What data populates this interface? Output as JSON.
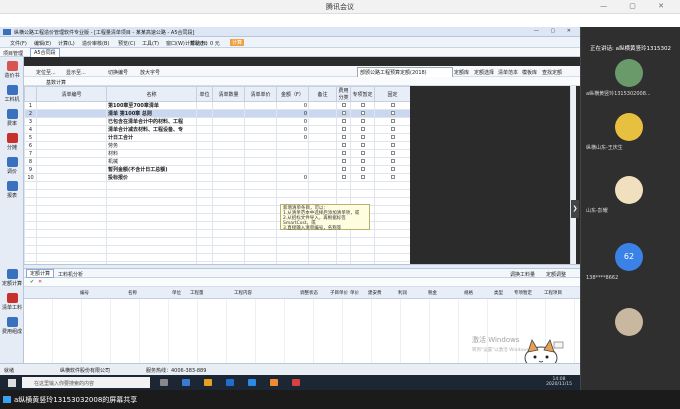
{
  "meeting": {
    "title": "腾讯会议"
  },
  "app": {
    "title": "纵横公路工程造价管理软件专业版 - [工程量清单项目 - 某某高速公路 - A5合同段]",
    "window_controls": "— ▢ ✕",
    "menus": [
      "文件(F)",
      "编辑(E)",
      "计算(L)",
      "造价审核(B)",
      "预览(C)",
      "工具(T)",
      "窗口(W)",
      "帮助(H)"
    ],
    "calc_status": "计算状态：0 元",
    "calc_label": "计算",
    "top_tabs": [
      "项目管理",
      "A5合同段"
    ],
    "sidebar": [
      {
        "label": "造价书",
        "color": "#d9534f"
      },
      {
        "label": "工料机",
        "color": "#3a70c0"
      },
      {
        "label": "费率",
        "color": "#3a70c0"
      },
      {
        "label": "分摊",
        "color": "#c9302c"
      },
      {
        "label": "调价",
        "color": "#3a70c0"
      },
      {
        "label": "报表",
        "color": "#3a70c0"
      },
      {
        "label": "定额计算",
        "color": "#3a70c0"
      },
      {
        "label": "清单工料",
        "color": "#c9302c"
      },
      {
        "label": "费用组成",
        "color": "#3a70c0"
      }
    ],
    "toolbar": [
      "定位至...",
      "显示至...",
      "切换编号",
      "放大字号"
    ],
    "standard_select": "部颁公路工程预算定额(2018)",
    "toolbar_right": [
      "定额库",
      "定额选择",
      "清单范本",
      "模板库",
      "查找定额"
    ],
    "sub_toolbar": [
      "基数计算"
    ],
    "grid": {
      "headers": [
        "",
        "清单编号",
        "名称",
        "单位",
        "清单数量",
        "清单单价",
        "金额（F）",
        "备注",
        "费用分类",
        "专项暂定",
        "固定"
      ],
      "rows": [
        {
          "no": "1",
          "code": "",
          "name": "第100章至700章清单",
          "amount": "0",
          "sel": false
        },
        {
          "no": "2",
          "code": "",
          "name": "清单 第100章 总则",
          "amount": "0",
          "sel": true
        },
        {
          "no": "3",
          "code": "",
          "name": "已包含在清单合计中的材料、工程",
          "amount": "0",
          "sel": false
        },
        {
          "no": "4",
          "code": "",
          "name": "清单合计减去材料、工程设备、专",
          "amount": "0",
          "sel": false
        },
        {
          "no": "5",
          "code": "",
          "name": "计日工合计",
          "amount": "0",
          "sel": false
        },
        {
          "no": "6",
          "code": "",
          "name": "劳务",
          "amount": "",
          "sel": false
        },
        {
          "no": "7",
          "code": "",
          "name": "材料",
          "amount": "",
          "sel": false
        },
        {
          "no": "8",
          "code": "",
          "name": "机械",
          "amount": "",
          "sel": false
        },
        {
          "no": "9",
          "code": "",
          "name": "暂列金额(不含计日工总额)",
          "amount": "",
          "sel": false
        },
        {
          "no": "10",
          "code": "",
          "name": "投标报价",
          "amount": "0",
          "sel": false
        }
      ]
    },
    "tooltip": "新增清单条目，可以：\n1.从清单范本中选择后添加清单项，或\n2.从招标文件导入，再根据标签SmartCost，或\n3.直接输入清单编号，名称等",
    "bottom_tabs": [
      "定额计算",
      "工料机分析"
    ],
    "bottom_right": [
      "调换工料量",
      "定额调整"
    ],
    "bottom_headers": [
      "编号",
      "名称",
      "单位",
      "工程量",
      "工程内容",
      "调整状态",
      "子目单价",
      "单价",
      "建安费",
      "利润",
      "税金",
      "规格",
      "类型",
      "专项暂定",
      "工程项目"
    ],
    "status": {
      "left": "就绪",
      "company": "纵横软件股份有限公司",
      "service": "服务热线：4006-383-889"
    }
  },
  "taskbar": {
    "search_placeholder": "在这里输入你要搜索的内容",
    "time": "14:08",
    "date": "2020/11/15"
  },
  "watermark": {
    "line1": "激活 Windows",
    "line2": "转到\"设置\"以激活 Windows。"
  },
  "meeting_panel": {
    "header": "正在讲话: a纵横黄竖玲1315302",
    "tiles": [
      {
        "name": "a纵横黄竖玲1315302008...",
        "avatar_color": "#6a9a6a"
      },
      {
        "name": "纵横山东-王庆生",
        "avatar_color": "#e8c040"
      },
      {
        "name": "山东-彭耀",
        "avatar_color": "#f0e0c0"
      },
      {
        "name": "138****8662",
        "avatar_color": "#3a82e8",
        "avatar_text": "62"
      },
      {
        "name": "",
        "avatar_color": "#c8b8a0"
      }
    ]
  },
  "share_banner": "a纵横黄竖玲13153032008的屏幕共享"
}
